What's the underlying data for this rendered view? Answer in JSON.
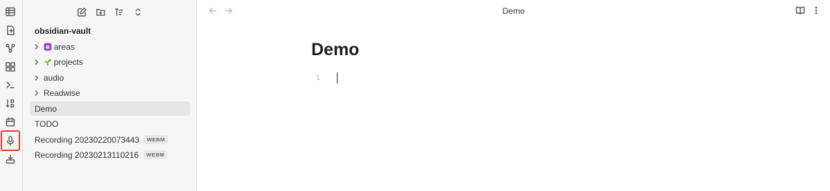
{
  "ribbon": {
    "items": [
      {
        "icon": "table-icon"
      },
      {
        "icon": "file-import-icon"
      },
      {
        "icon": "graph-icon"
      },
      {
        "icon": "layout-grid-icon"
      },
      {
        "icon": "terminal-icon"
      },
      {
        "icon": "sort-icon"
      },
      {
        "icon": "calendar-icon"
      },
      {
        "icon": "microphone-icon",
        "highlighted": true,
        "highlight_color": "#e53935"
      },
      {
        "icon": "download-icon"
      }
    ]
  },
  "sidebar": {
    "toolbar": [
      "new-note-icon",
      "new-folder-icon",
      "sort-order-icon",
      "collapse-expand-icon"
    ],
    "vault_name": "obsidian-vault",
    "folders": [
      {
        "label": "areas",
        "emoji": "purple-e-icon"
      },
      {
        "label": "projects",
        "emoji": "sprout-icon"
      },
      {
        "label": "audio"
      },
      {
        "label": "Readwise"
      }
    ],
    "files": [
      {
        "label": "Demo",
        "active": true
      },
      {
        "label": "TODO"
      },
      {
        "label": "Recording 20230220073443",
        "badge": "WEBM"
      },
      {
        "label": "Recording 20230213110216",
        "badge": "WEBM"
      }
    ]
  },
  "main": {
    "tab_title": "Demo",
    "doc_title": "Demo",
    "line_number": "1"
  },
  "colors": {
    "sidebar_bg": "#f6f6f6",
    "active_item_bg": "#e6e6e6",
    "highlight": "#e53935"
  }
}
